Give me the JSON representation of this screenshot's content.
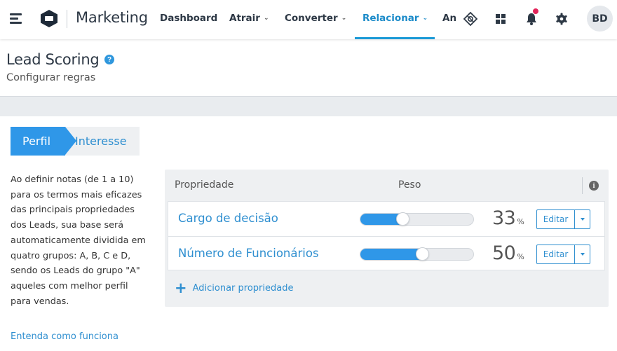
{
  "topnav": {
    "brand": "Marketing",
    "items": [
      {
        "label": "Dashboard",
        "has_dropdown": false,
        "active": false
      },
      {
        "label": "Atrair",
        "has_dropdown": true,
        "active": false
      },
      {
        "label": "Converter",
        "has_dropdown": true,
        "active": false
      },
      {
        "label": "Relacionar",
        "has_dropdown": true,
        "active": true
      },
      {
        "label": "An",
        "has_dropdown": false,
        "active": false
      }
    ],
    "icons": [
      "menu-icon",
      "integration-icon",
      "apps-grid-icon",
      "bell-icon",
      "gear-icon"
    ],
    "avatar_initials": "BD"
  },
  "header": {
    "title": "Lead Scoring",
    "help_glyph": "?",
    "subtitle": "Configurar regras"
  },
  "tabs": {
    "perfil": "Perfil",
    "interesse": "Interesse"
  },
  "description": "Ao definir notas (de 1 a 10) para os termos mais eficazes das principais propriedades dos Leads, sua base será automaticamente dividida em quatro grupos: A, B, C e D, sendo os Leads do grupo \"A\" aqueles com melhor perfil para vendas.",
  "learn_link": "Entenda como funciona",
  "table": {
    "col_property": "Propriedade",
    "col_weight": "Peso",
    "info_glyph": "i",
    "rows": [
      {
        "name": "Cargo de decisão",
        "weight": "33",
        "unit": "%",
        "fraction": 0.33,
        "edit_label": "Editar"
      },
      {
        "name": "Número de Funcionários",
        "weight": "50",
        "unit": "%",
        "fraction": 0.5,
        "edit_label": "Editar"
      }
    ],
    "add_label": "Adicionar propriedade",
    "add_glyph": "+"
  },
  "colors": {
    "accent": "#2f97e8",
    "link": "#2f8fd0",
    "notification": "#e3245a",
    "text_dark": "#2d3845"
  }
}
